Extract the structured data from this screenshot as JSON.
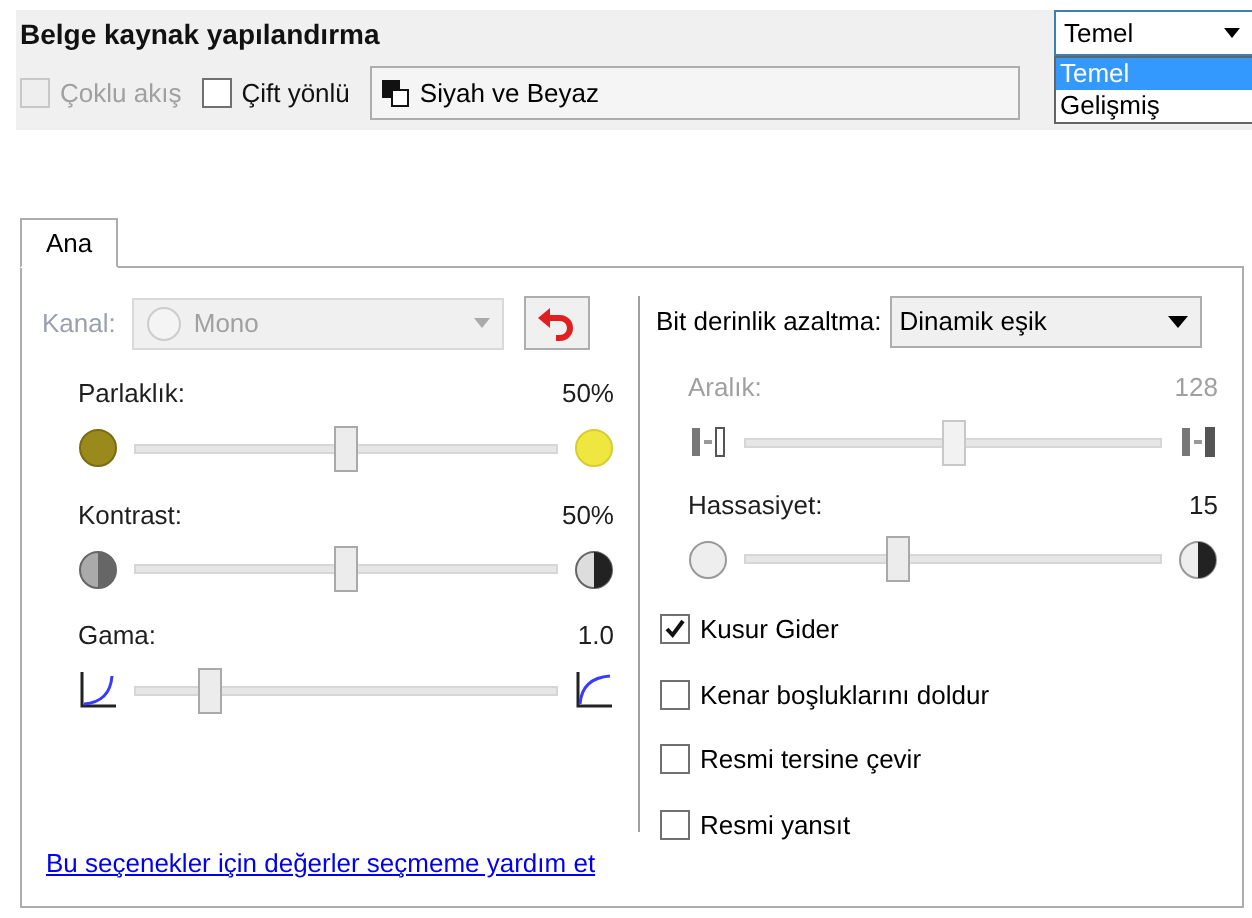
{
  "header": {
    "title": "Belge kaynak yapılandırma",
    "mode_select": {
      "value": "Temel",
      "expanded": true,
      "options": [
        {
          "label": "Temel",
          "selected": true
        },
        {
          "label": "Gelişmiş",
          "selected": false
        }
      ]
    },
    "options": [
      {
        "label": "Çoklu akış",
        "checked": false,
        "disabled": true
      },
      {
        "label": "Çift yönlü",
        "checked": false,
        "disabled": false
      }
    ],
    "profile": "Siyah ve Beyaz"
  },
  "tabs": [
    {
      "label": "Ana",
      "selected": true
    }
  ],
  "left": {
    "channel": {
      "label": "Kanal:",
      "value": "Mono",
      "disabled": true
    },
    "sliders": [
      {
        "kind": "brightness",
        "label": "Parlaklık:",
        "reading": "50%",
        "level": 0.5,
        "disabled": false
      },
      {
        "kind": "contrast",
        "label": "Kontrast:",
        "reading": "50%",
        "level": 0.5,
        "disabled": false
      },
      {
        "kind": "gamma",
        "label": "Gama:",
        "reading": "1.0",
        "level": 0.16,
        "disabled": false
      }
    ]
  },
  "right": {
    "bit_depth": {
      "label": "Bit derinlik azaltma:",
      "value": "Dinamik eşik"
    },
    "sliders": [
      {
        "kind": "range",
        "label": "Aralık:",
        "reading": "128",
        "level": 0.5,
        "disabled": true
      },
      {
        "kind": "sensitivity",
        "label": "Hassasiyet:",
        "reading": "15",
        "level": 0.36,
        "disabled": false
      }
    ],
    "checkboxes": [
      {
        "label": "Kusur Gider",
        "checked": true
      },
      {
        "label": "Kenar boşluklarını doldur",
        "checked": false
      },
      {
        "label": "Resmi tersine çevir",
        "checked": false
      },
      {
        "label": "Resmi yansıt",
        "checked": false
      }
    ]
  },
  "help_link": "Bu seçenekler için değerler seçmeme yardım et"
}
